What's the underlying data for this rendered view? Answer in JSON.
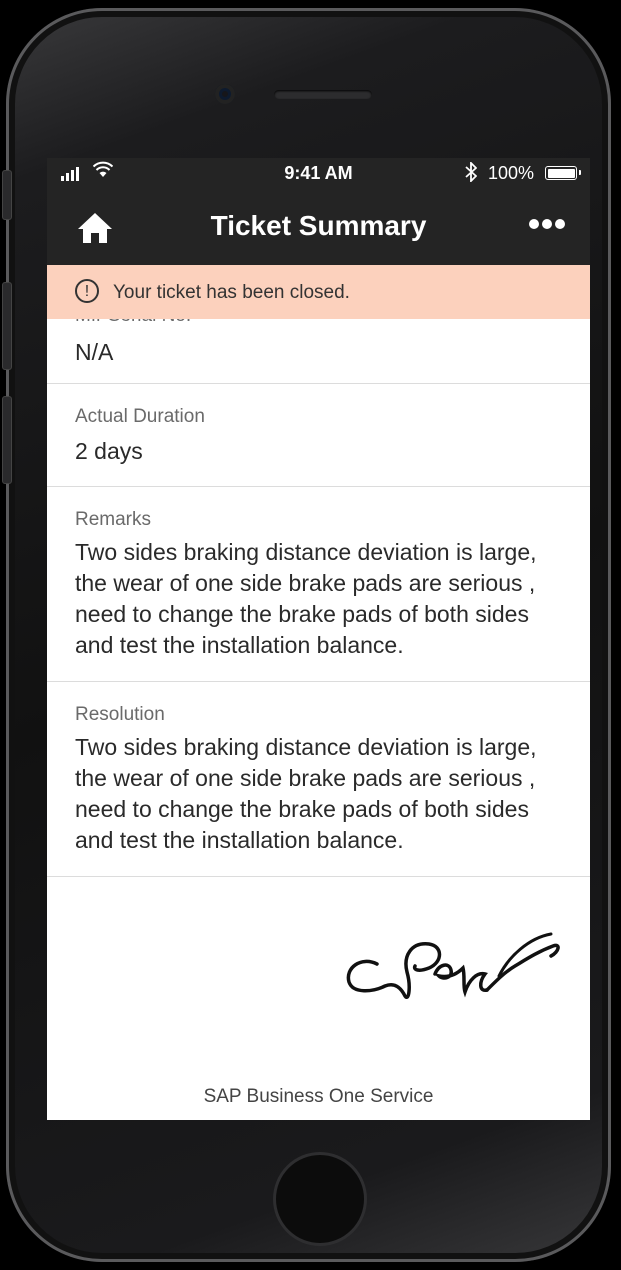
{
  "status_bar": {
    "time": "9:41 AM",
    "battery_percent": "100%",
    "signal_icon": "cellular-signal-icon",
    "wifi_icon": "wifi-icon",
    "bluetooth_icon": "bluetooth-icon",
    "battery_level": 1.0
  },
  "nav": {
    "title": "Ticket Summary",
    "home_icon": "home-icon",
    "more_icon": "more-options-icon"
  },
  "banner": {
    "message": "Your ticket has been closed.",
    "icon": "alert-circle-icon",
    "background_color": "#fcd1bd"
  },
  "fields": {
    "serial": {
      "label": "Mfr Serial No.",
      "value": "N/A"
    },
    "duration": {
      "label": "Actual Duration",
      "value": "2 days"
    },
    "remarks": {
      "label": "Remarks",
      "value": "Two sides braking distance deviation is large, the wear of one side brake pads are serious , need to change the brake pads of both sides and test the installation balance."
    },
    "resolution": {
      "label": "Resolution",
      "value": "Two sides braking distance deviation is large, the wear of one side brake pads are serious , need to change the brake pads of both sides and test the installation balance."
    }
  },
  "signature_icon": "handwritten-signature",
  "footer": {
    "text": "SAP Business One Service"
  }
}
